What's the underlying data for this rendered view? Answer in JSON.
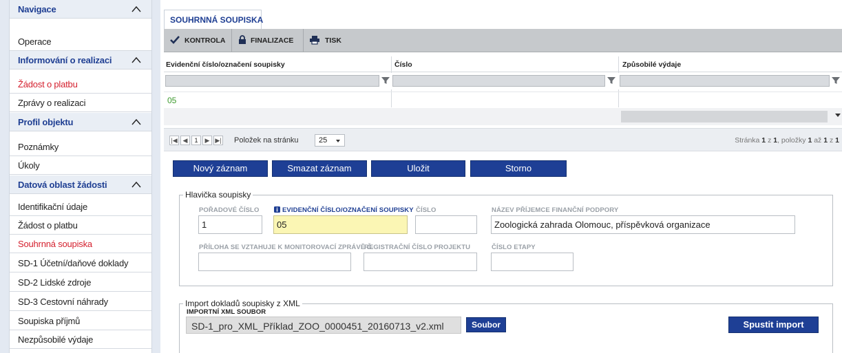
{
  "sidebar": {
    "items": [
      {
        "label": "Navigace",
        "type": "header"
      },
      {
        "label": "Operace",
        "type": "item"
      },
      {
        "label": "Informování o realizaci",
        "type": "header"
      },
      {
        "label": "Žádost o platbu",
        "type": "item",
        "active": true
      },
      {
        "label": "Zprávy o realizaci",
        "type": "item"
      },
      {
        "label": "Profil objektu",
        "type": "header"
      },
      {
        "label": "Poznámky",
        "type": "item"
      },
      {
        "label": "Úkoly",
        "type": "item"
      },
      {
        "label": "Datová oblast žádosti",
        "type": "header"
      },
      {
        "label": "Identifikační údaje",
        "type": "item"
      },
      {
        "label": "Žádost o platbu",
        "type": "item"
      },
      {
        "label": "Souhrnná soupiska",
        "type": "item",
        "active": true
      },
      {
        "label": "SD-1 Účetní/daňové doklady",
        "type": "item"
      },
      {
        "label": "SD-2 Lidské zdroje",
        "type": "item"
      },
      {
        "label": "SD-3 Cestovní náhrady",
        "type": "item"
      },
      {
        "label": "Soupiska příjmů",
        "type": "item"
      },
      {
        "label": "Nezpůsobilé výdaje",
        "type": "item"
      }
    ]
  },
  "tab": {
    "label": "SOUHRNNÁ SOUPISKA"
  },
  "toolbar": {
    "kontrola": "KONTROLA",
    "finalizace": "FINALIZACE",
    "tisk": "TISK"
  },
  "grid": {
    "columns": [
      "Evidenční číslo/označení soupisky",
      "Číslo",
      "Způsobilé výdaje"
    ],
    "rows": [
      [
        "05",
        "",
        ""
      ]
    ]
  },
  "pager": {
    "page": "1",
    "per_page_label": "Položek na stránku",
    "per_page": "25",
    "info": {
      "page_word": "Stránka",
      "page": "1",
      "of_word": "z",
      "pages": "1",
      "items_word": ", položky",
      "from": "1",
      "to_word": "až",
      "to": "1",
      "of2_word": "z",
      "total": "1"
    }
  },
  "actions": {
    "new": "Nový záznam",
    "delete": "Smazat záznam",
    "save": "Uložit",
    "cancel": "Storno"
  },
  "header_section": {
    "legend": "Hlavička soupisky",
    "fields": {
      "poradove_label": "POŘADOVÉ ČÍSLO",
      "poradove_value": "1",
      "evidencni_label": "EVIDENČNÍ ČÍSLO/OZNAČENÍ SOUPISKY",
      "evidencni_value": "05",
      "cislo_label": "ČÍSLO",
      "cislo_value": "",
      "prijemce_label": "NÁZEV PŘÍJEMCE FINANČNÍ PODPORY",
      "prijemce_value": "Zoologická zahrada Olomouc,  příspěvková organizace",
      "priloha_label": "PŘÍLOHA SE VZTAHUJE K MONITOROVACÍ ZPRÁVĚ Č.",
      "priloha_value": "",
      "registracni_label": "REGISTRAČNÍ ČÍSLO PROJEKTU",
      "registracni_value": "",
      "etapa_label": "ČÍSLO ETAPY",
      "etapa_value": ""
    }
  },
  "import_section": {
    "legend": "Import dokladů soupisky z XML",
    "file_label": "IMPORTNÍ XML SOUBOR",
    "file_value": "SD-1_pro_XML_Příklad_ZOO_0000451_20160713_v2.xml",
    "file_button": "Soubor",
    "run_button": "Spustit import"
  },
  "colors": {
    "accent": "#1e3f95",
    "active": "#d4202e",
    "value_green": "#3c9a2d",
    "highlight": "#fbf6b4"
  }
}
